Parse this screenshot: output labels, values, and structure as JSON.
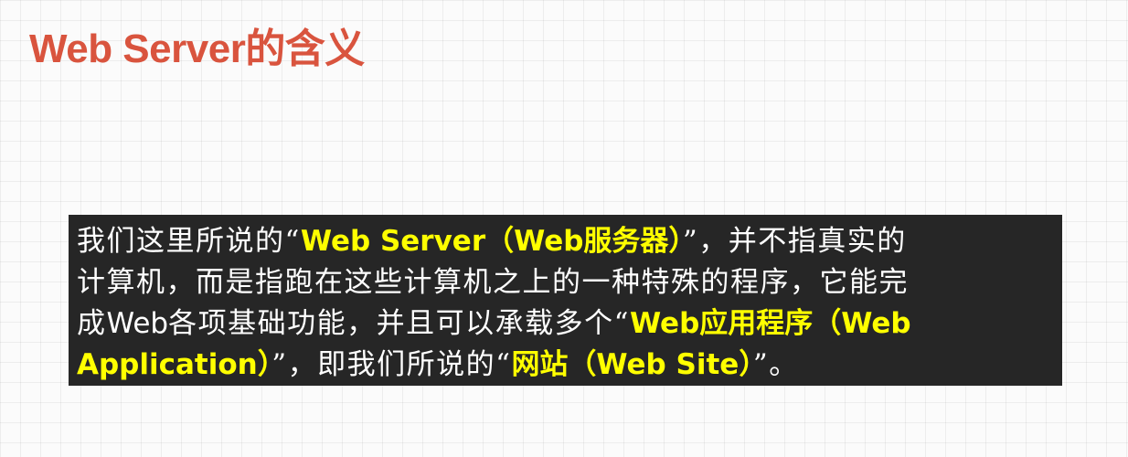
{
  "slide": {
    "title": "Web Server的含义"
  },
  "callout": {
    "line1": {
      "pre": "我们这里所说的“",
      "highlight": "Web Server（Web服务器）",
      "post": "”，并不指真实的"
    },
    "line2": {
      "text": "计算机，而是指跑在这些计算机之上的一种特殊的程序，它能完"
    },
    "line3": {
      "pre1": "成",
      "pre2": "Web",
      "pre3": "各项基础功能，并且可以承载多个“",
      "highlight": "Web应用程序（Web"
    },
    "line4": {
      "highlight1": "Application）",
      "mid": "”，即我们所说的“",
      "highlight2": "网站（Web Site）",
      "post": "”。"
    }
  },
  "colors": {
    "title": "#d9543e",
    "callout_background": "#262626",
    "highlight": "#ffff00",
    "body_text": "#ffffff"
  }
}
